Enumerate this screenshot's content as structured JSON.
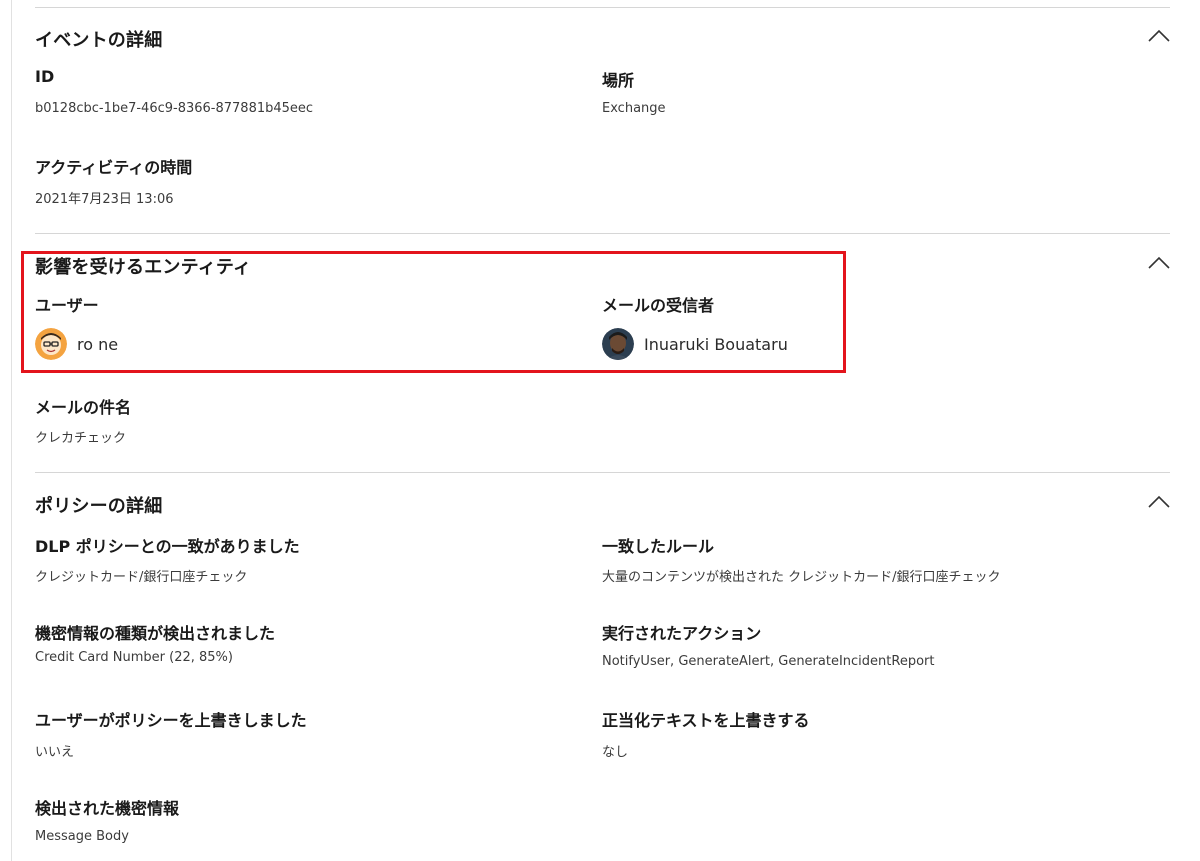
{
  "event_details": {
    "title": "イベントの詳細",
    "id_label": "ID",
    "id_value": "b0128cbc-1be7-46c9-8366-877881b45eec",
    "location_label": "場所",
    "location_value": "Exchange",
    "activity_time_label": "アクティビティの時間",
    "activity_time_value": "2021年7月23日 13:06"
  },
  "affected_entities": {
    "title": "影響を受けるエンティティ",
    "user_label": "ユーザー",
    "user_name": "ro ne",
    "recipient_label": "メールの受信者",
    "recipient_name": "Inuaruki Bouataru",
    "subject_label": "メールの件名",
    "subject_value": "クレカチェック"
  },
  "policy_details": {
    "title": "ポリシーの詳細",
    "dlp_match_label": "DLP ポリシーとの一致がありました",
    "dlp_match_value": "クレジットカード/銀行口座チェック",
    "matched_rule_label": "一致したルール",
    "matched_rule_value": "大量のコンテンツが検出された クレジットカード/銀行口座チェック",
    "sensitive_type_label": "機密情報の種類が検出されました",
    "sensitive_type_value": "Credit Card Number (22, 85%)",
    "actions_label": "実行されたアクション",
    "actions_value": "NotifyUser, GenerateAlert, GenerateIncidentReport",
    "user_override_label": "ユーザーがポリシーを上書きしました",
    "user_override_value": "いいえ",
    "justification_label": "正当化テキストを上書きする",
    "justification_value": "なし",
    "detected_info_label": "検出された機密情報",
    "detected_info_value": "Message Body"
  },
  "icons": {
    "collapse": "chevron-up-icon",
    "user_avatar": "cartoon-avatar-icon",
    "recipient_avatar": "photo-avatar-icon"
  },
  "colors": {
    "highlight_border": "#e3141c",
    "divider": "#d6d6d6"
  }
}
